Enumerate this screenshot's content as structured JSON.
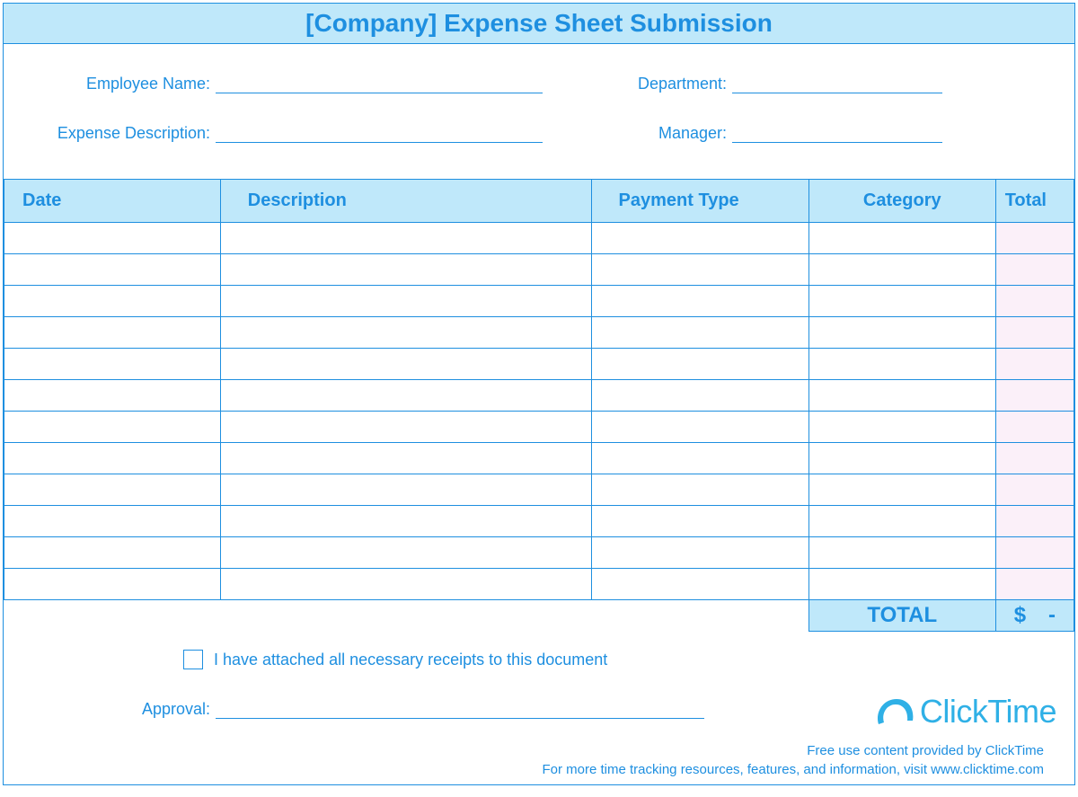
{
  "header": {
    "title": "[Company] Expense Sheet Submission"
  },
  "info": {
    "employee_name_label": "Employee Name:",
    "department_label": "Department:",
    "expense_desc_label": "Expense Description:",
    "manager_label": "Manager:",
    "employee_name_value": "",
    "department_value": "",
    "expense_desc_value": "",
    "manager_value": ""
  },
  "table": {
    "headers": {
      "date": "Date",
      "description": "Description",
      "payment_type": "Payment Type",
      "category": "Category",
      "total": "Total"
    },
    "rows": [
      {
        "date": "",
        "description": "",
        "payment_type": "",
        "category": "",
        "total": ""
      },
      {
        "date": "",
        "description": "",
        "payment_type": "",
        "category": "",
        "total": ""
      },
      {
        "date": "",
        "description": "",
        "payment_type": "",
        "category": "",
        "total": ""
      },
      {
        "date": "",
        "description": "",
        "payment_type": "",
        "category": "",
        "total": ""
      },
      {
        "date": "",
        "description": "",
        "payment_type": "",
        "category": "",
        "total": ""
      },
      {
        "date": "",
        "description": "",
        "payment_type": "",
        "category": "",
        "total": ""
      },
      {
        "date": "",
        "description": "",
        "payment_type": "",
        "category": "",
        "total": ""
      },
      {
        "date": "",
        "description": "",
        "payment_type": "",
        "category": "",
        "total": ""
      },
      {
        "date": "",
        "description": "",
        "payment_type": "",
        "category": "",
        "total": ""
      },
      {
        "date": "",
        "description": "",
        "payment_type": "",
        "category": "",
        "total": ""
      },
      {
        "date": "",
        "description": "",
        "payment_type": "",
        "category": "",
        "total": ""
      },
      {
        "date": "",
        "description": "",
        "payment_type": "",
        "category": "",
        "total": ""
      }
    ],
    "total_label": "TOTAL",
    "total_currency": "$",
    "total_value": "-"
  },
  "bottom": {
    "receipts_label": "I have attached all necessary receipts to this document",
    "receipts_checked": false,
    "approval_label": "Approval:",
    "approval_value": ""
  },
  "branding": {
    "logo_text": "ClickTime",
    "line1": "Free use content provided by ClickTime",
    "line2": "For more time tracking resources, features, and information, visit www.clicktime.com"
  }
}
